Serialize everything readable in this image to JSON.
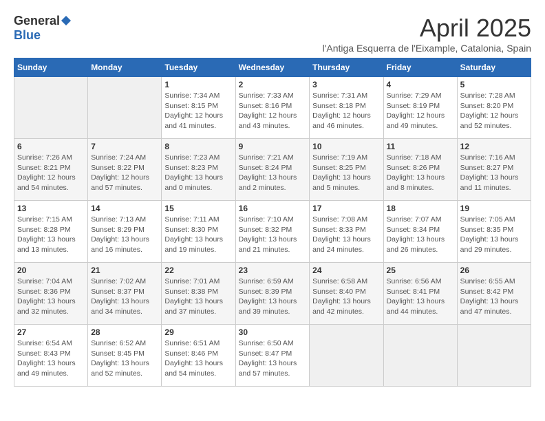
{
  "logo": {
    "general": "General",
    "blue": "Blue",
    "tagline": ""
  },
  "header": {
    "title": "April 2025",
    "subtitle": "l'Antiga Esquerra de l'Eixample, Catalonia, Spain"
  },
  "weekdays": [
    "Sunday",
    "Monday",
    "Tuesday",
    "Wednesday",
    "Thursday",
    "Friday",
    "Saturday"
  ],
  "weeks": [
    [
      {
        "day": "",
        "info": ""
      },
      {
        "day": "",
        "info": ""
      },
      {
        "day": "1",
        "info": "Sunrise: 7:34 AM\nSunset: 8:15 PM\nDaylight: 12 hours and 41 minutes."
      },
      {
        "day": "2",
        "info": "Sunrise: 7:33 AM\nSunset: 8:16 PM\nDaylight: 12 hours and 43 minutes."
      },
      {
        "day": "3",
        "info": "Sunrise: 7:31 AM\nSunset: 8:18 PM\nDaylight: 12 hours and 46 minutes."
      },
      {
        "day": "4",
        "info": "Sunrise: 7:29 AM\nSunset: 8:19 PM\nDaylight: 12 hours and 49 minutes."
      },
      {
        "day": "5",
        "info": "Sunrise: 7:28 AM\nSunset: 8:20 PM\nDaylight: 12 hours and 52 minutes."
      }
    ],
    [
      {
        "day": "6",
        "info": "Sunrise: 7:26 AM\nSunset: 8:21 PM\nDaylight: 12 hours and 54 minutes."
      },
      {
        "day": "7",
        "info": "Sunrise: 7:24 AM\nSunset: 8:22 PM\nDaylight: 12 hours and 57 minutes."
      },
      {
        "day": "8",
        "info": "Sunrise: 7:23 AM\nSunset: 8:23 PM\nDaylight: 13 hours and 0 minutes."
      },
      {
        "day": "9",
        "info": "Sunrise: 7:21 AM\nSunset: 8:24 PM\nDaylight: 13 hours and 2 minutes."
      },
      {
        "day": "10",
        "info": "Sunrise: 7:19 AM\nSunset: 8:25 PM\nDaylight: 13 hours and 5 minutes."
      },
      {
        "day": "11",
        "info": "Sunrise: 7:18 AM\nSunset: 8:26 PM\nDaylight: 13 hours and 8 minutes."
      },
      {
        "day": "12",
        "info": "Sunrise: 7:16 AM\nSunset: 8:27 PM\nDaylight: 13 hours and 11 minutes."
      }
    ],
    [
      {
        "day": "13",
        "info": "Sunrise: 7:15 AM\nSunset: 8:28 PM\nDaylight: 13 hours and 13 minutes."
      },
      {
        "day": "14",
        "info": "Sunrise: 7:13 AM\nSunset: 8:29 PM\nDaylight: 13 hours and 16 minutes."
      },
      {
        "day": "15",
        "info": "Sunrise: 7:11 AM\nSunset: 8:30 PM\nDaylight: 13 hours and 19 minutes."
      },
      {
        "day": "16",
        "info": "Sunrise: 7:10 AM\nSunset: 8:32 PM\nDaylight: 13 hours and 21 minutes."
      },
      {
        "day": "17",
        "info": "Sunrise: 7:08 AM\nSunset: 8:33 PM\nDaylight: 13 hours and 24 minutes."
      },
      {
        "day": "18",
        "info": "Sunrise: 7:07 AM\nSunset: 8:34 PM\nDaylight: 13 hours and 26 minutes."
      },
      {
        "day": "19",
        "info": "Sunrise: 7:05 AM\nSunset: 8:35 PM\nDaylight: 13 hours and 29 minutes."
      }
    ],
    [
      {
        "day": "20",
        "info": "Sunrise: 7:04 AM\nSunset: 8:36 PM\nDaylight: 13 hours and 32 minutes."
      },
      {
        "day": "21",
        "info": "Sunrise: 7:02 AM\nSunset: 8:37 PM\nDaylight: 13 hours and 34 minutes."
      },
      {
        "day": "22",
        "info": "Sunrise: 7:01 AM\nSunset: 8:38 PM\nDaylight: 13 hours and 37 minutes."
      },
      {
        "day": "23",
        "info": "Sunrise: 6:59 AM\nSunset: 8:39 PM\nDaylight: 13 hours and 39 minutes."
      },
      {
        "day": "24",
        "info": "Sunrise: 6:58 AM\nSunset: 8:40 PM\nDaylight: 13 hours and 42 minutes."
      },
      {
        "day": "25",
        "info": "Sunrise: 6:56 AM\nSunset: 8:41 PM\nDaylight: 13 hours and 44 minutes."
      },
      {
        "day": "26",
        "info": "Sunrise: 6:55 AM\nSunset: 8:42 PM\nDaylight: 13 hours and 47 minutes."
      }
    ],
    [
      {
        "day": "27",
        "info": "Sunrise: 6:54 AM\nSunset: 8:43 PM\nDaylight: 13 hours and 49 minutes."
      },
      {
        "day": "28",
        "info": "Sunrise: 6:52 AM\nSunset: 8:45 PM\nDaylight: 13 hours and 52 minutes."
      },
      {
        "day": "29",
        "info": "Sunrise: 6:51 AM\nSunset: 8:46 PM\nDaylight: 13 hours and 54 minutes."
      },
      {
        "day": "30",
        "info": "Sunrise: 6:50 AM\nSunset: 8:47 PM\nDaylight: 13 hours and 57 minutes."
      },
      {
        "day": "",
        "info": ""
      },
      {
        "day": "",
        "info": ""
      },
      {
        "day": "",
        "info": ""
      }
    ]
  ]
}
